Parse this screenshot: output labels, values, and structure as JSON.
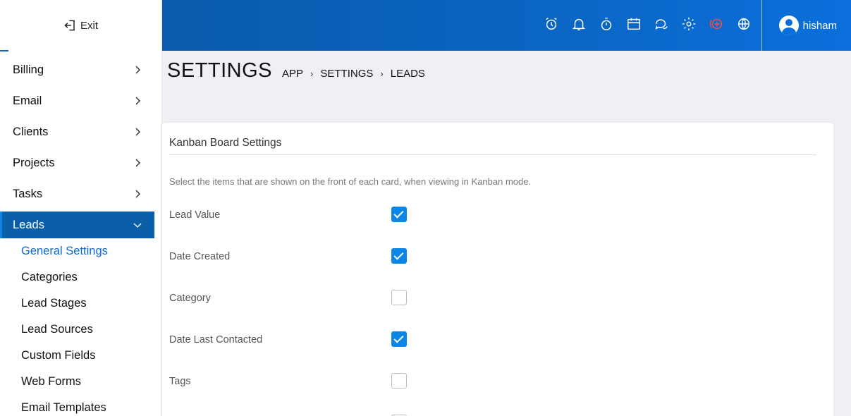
{
  "sidebar": {
    "exit_label": "Exit",
    "items": [
      {
        "label": "Billing"
      },
      {
        "label": "Email"
      },
      {
        "label": "Clients"
      },
      {
        "label": "Projects"
      },
      {
        "label": "Tasks"
      }
    ],
    "active": {
      "label": "Leads"
    },
    "subitems": [
      {
        "label": "General Settings"
      },
      {
        "label": "Categories"
      },
      {
        "label": "Lead Stages"
      },
      {
        "label": "Lead Sources"
      },
      {
        "label": "Custom Fields"
      },
      {
        "label": "Web Forms"
      },
      {
        "label": "Email Templates"
      }
    ]
  },
  "header": {
    "icons": [
      "alarm-icon",
      "bell-icon",
      "stopwatch-icon",
      "calendar-icon",
      "chat-icon",
      "gear-icon",
      "add-circle-icon",
      "globe-icon"
    ],
    "user_name": "hisham"
  },
  "page": {
    "title": "SETTINGS",
    "breadcrumb": [
      "APP",
      "SETTINGS",
      "LEADS"
    ]
  },
  "card": {
    "title": "Kanban Board Settings",
    "description": "Select the items that are shown on the front of each card, when viewing in Kanban mode.",
    "settings": [
      {
        "label": "Lead Value",
        "checked": true
      },
      {
        "label": "Date Created",
        "checked": true
      },
      {
        "label": "Category",
        "checked": false
      },
      {
        "label": "Date Last Contacted",
        "checked": true
      },
      {
        "label": "Tags",
        "checked": false
      }
    ]
  },
  "colors": {
    "header_gradient": [
      "#0a5cad",
      "#0a6fdc"
    ],
    "active_menu": "#0b5fa8",
    "checkbox": "#0a86e6",
    "accent_icon": "#f0484f"
  }
}
